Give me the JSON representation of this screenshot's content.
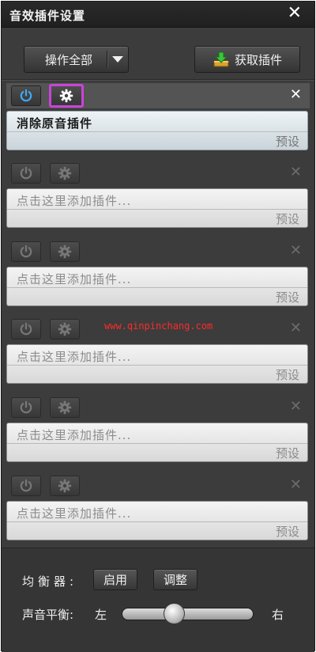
{
  "window": {
    "title": "音效插件设置",
    "close": "✕"
  },
  "toolbar": {
    "operate_all_label": "操作全部",
    "get_plugins_label": "获取插件"
  },
  "slots": [
    {
      "name": "消除原音插件",
      "preset": "预设",
      "active": true
    },
    {
      "name": "点击这里添加插件...",
      "preset": "预设",
      "active": false
    },
    {
      "name": "点击这里添加插件...",
      "preset": "预设",
      "active": false
    },
    {
      "name": "点击这里添加插件...",
      "preset": "预设",
      "active": false
    },
    {
      "name": "点击这里添加插件...",
      "preset": "预设",
      "active": false
    },
    {
      "name": "点击这里添加插件...",
      "preset": "预设",
      "active": false
    }
  ],
  "slot_close": "✕",
  "watermark": "www.qinpinchang.com",
  "equalizer": {
    "label": "均衡器:",
    "enable_label": "启用",
    "adjust_label": "调整"
  },
  "balance": {
    "label": "声音平衡:",
    "left_label": "左",
    "right_label": "右",
    "value": 0.38
  },
  "colors": {
    "accent": "#1e90ff",
    "highlight": "#c844d8"
  },
  "icons": {
    "power": "power-icon",
    "settings": "gear-icon",
    "download": "download-icon"
  }
}
